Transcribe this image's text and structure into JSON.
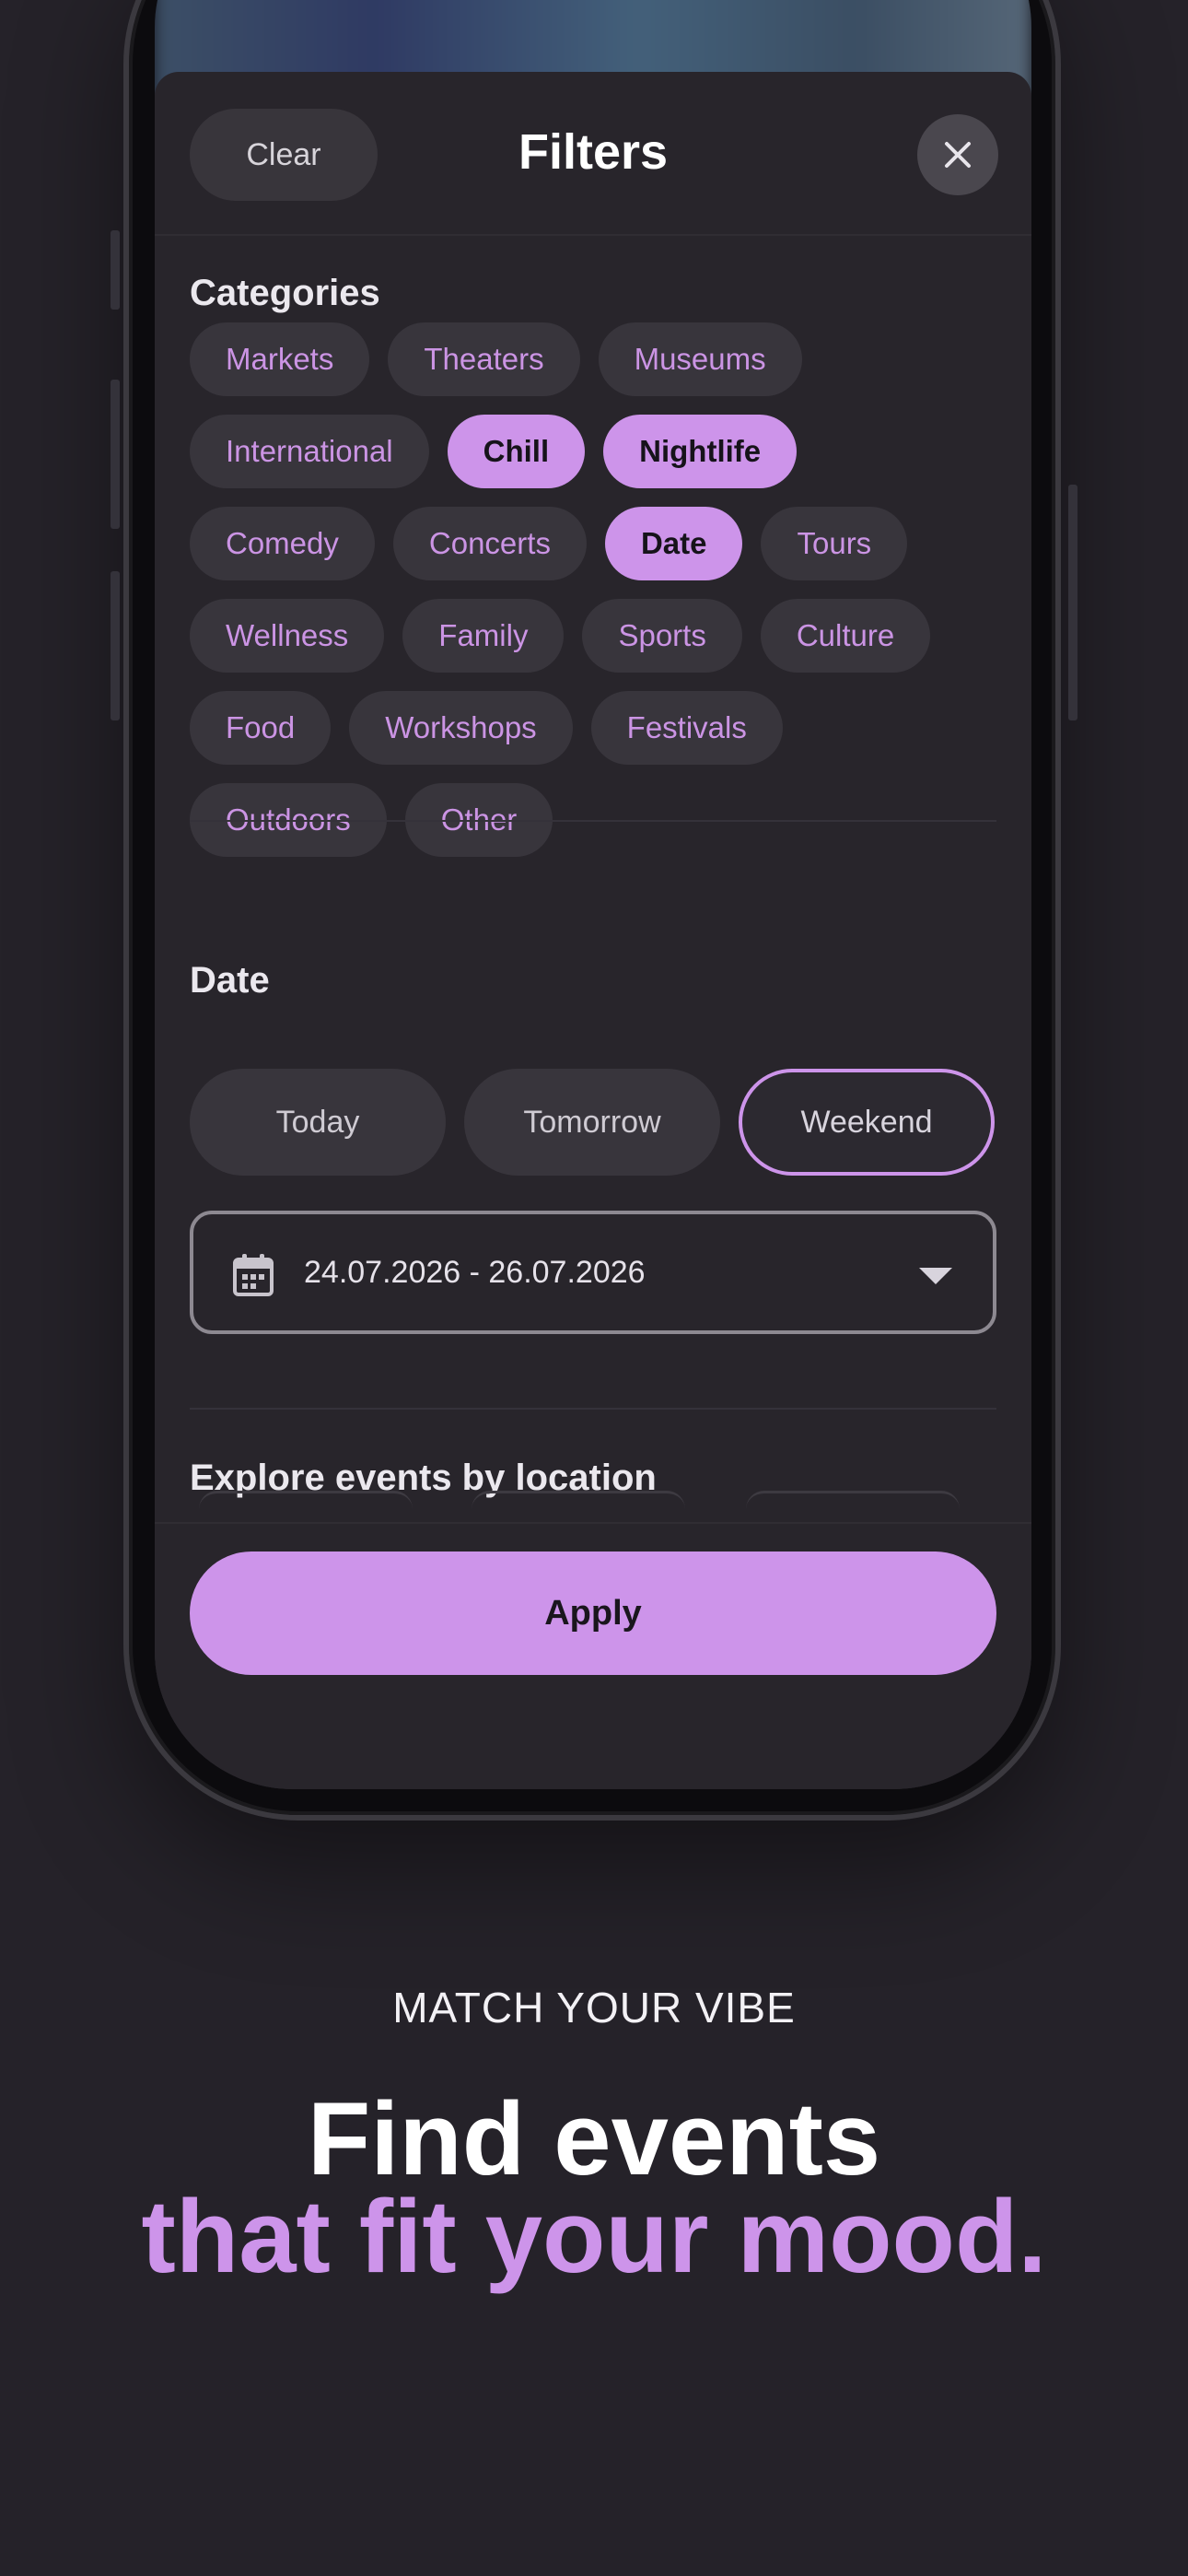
{
  "filters": {
    "clear_label": "Clear",
    "title": "Filters",
    "close_icon": "close-icon",
    "categories": {
      "title": "Categories",
      "rows": [
        [
          {
            "label": "Markets",
            "selected": false
          },
          {
            "label": "Theaters",
            "selected": false
          },
          {
            "label": "Museums",
            "selected": false
          }
        ],
        [
          {
            "label": "International",
            "selected": false
          },
          {
            "label": "Chill",
            "selected": true
          },
          {
            "label": "Nightlife",
            "selected": true
          }
        ],
        [
          {
            "label": "Comedy",
            "selected": false
          },
          {
            "label": "Concerts",
            "selected": false
          },
          {
            "label": "Date",
            "selected": true
          },
          {
            "label": "Tours",
            "selected": false
          }
        ],
        [
          {
            "label": "Wellness",
            "selected": false
          },
          {
            "label": "Family",
            "selected": false
          },
          {
            "label": "Sports",
            "selected": false
          },
          {
            "label": "Culture",
            "selected": false
          }
        ],
        [
          {
            "label": "Food",
            "selected": false
          },
          {
            "label": "Workshops",
            "selected": false
          },
          {
            "label": "Festivals",
            "selected": false
          }
        ],
        [
          {
            "label": "Outdoors",
            "selected": false
          },
          {
            "label": "Other",
            "selected": false
          }
        ]
      ]
    },
    "date": {
      "title": "Date",
      "options": [
        {
          "label": "Today",
          "selected": false
        },
        {
          "label": "Tomorrow",
          "selected": false
        },
        {
          "label": "Weekend",
          "selected": true
        }
      ],
      "range_value": "24.07.2026 - 26.07.2026",
      "calendar_icon": "calendar-icon",
      "dropdown_icon": "chevron-down-icon"
    },
    "location": {
      "title": "Explore events by location"
    },
    "apply_label": "Apply"
  },
  "marketing": {
    "eyebrow": "MATCH YOUR VIBE",
    "headline_line1": "Find events",
    "headline_line2": "that fit your mood."
  },
  "colors": {
    "accent": "#cd94ea",
    "background": "#252229",
    "sheet": "#28252b",
    "chip": "#38353c"
  }
}
